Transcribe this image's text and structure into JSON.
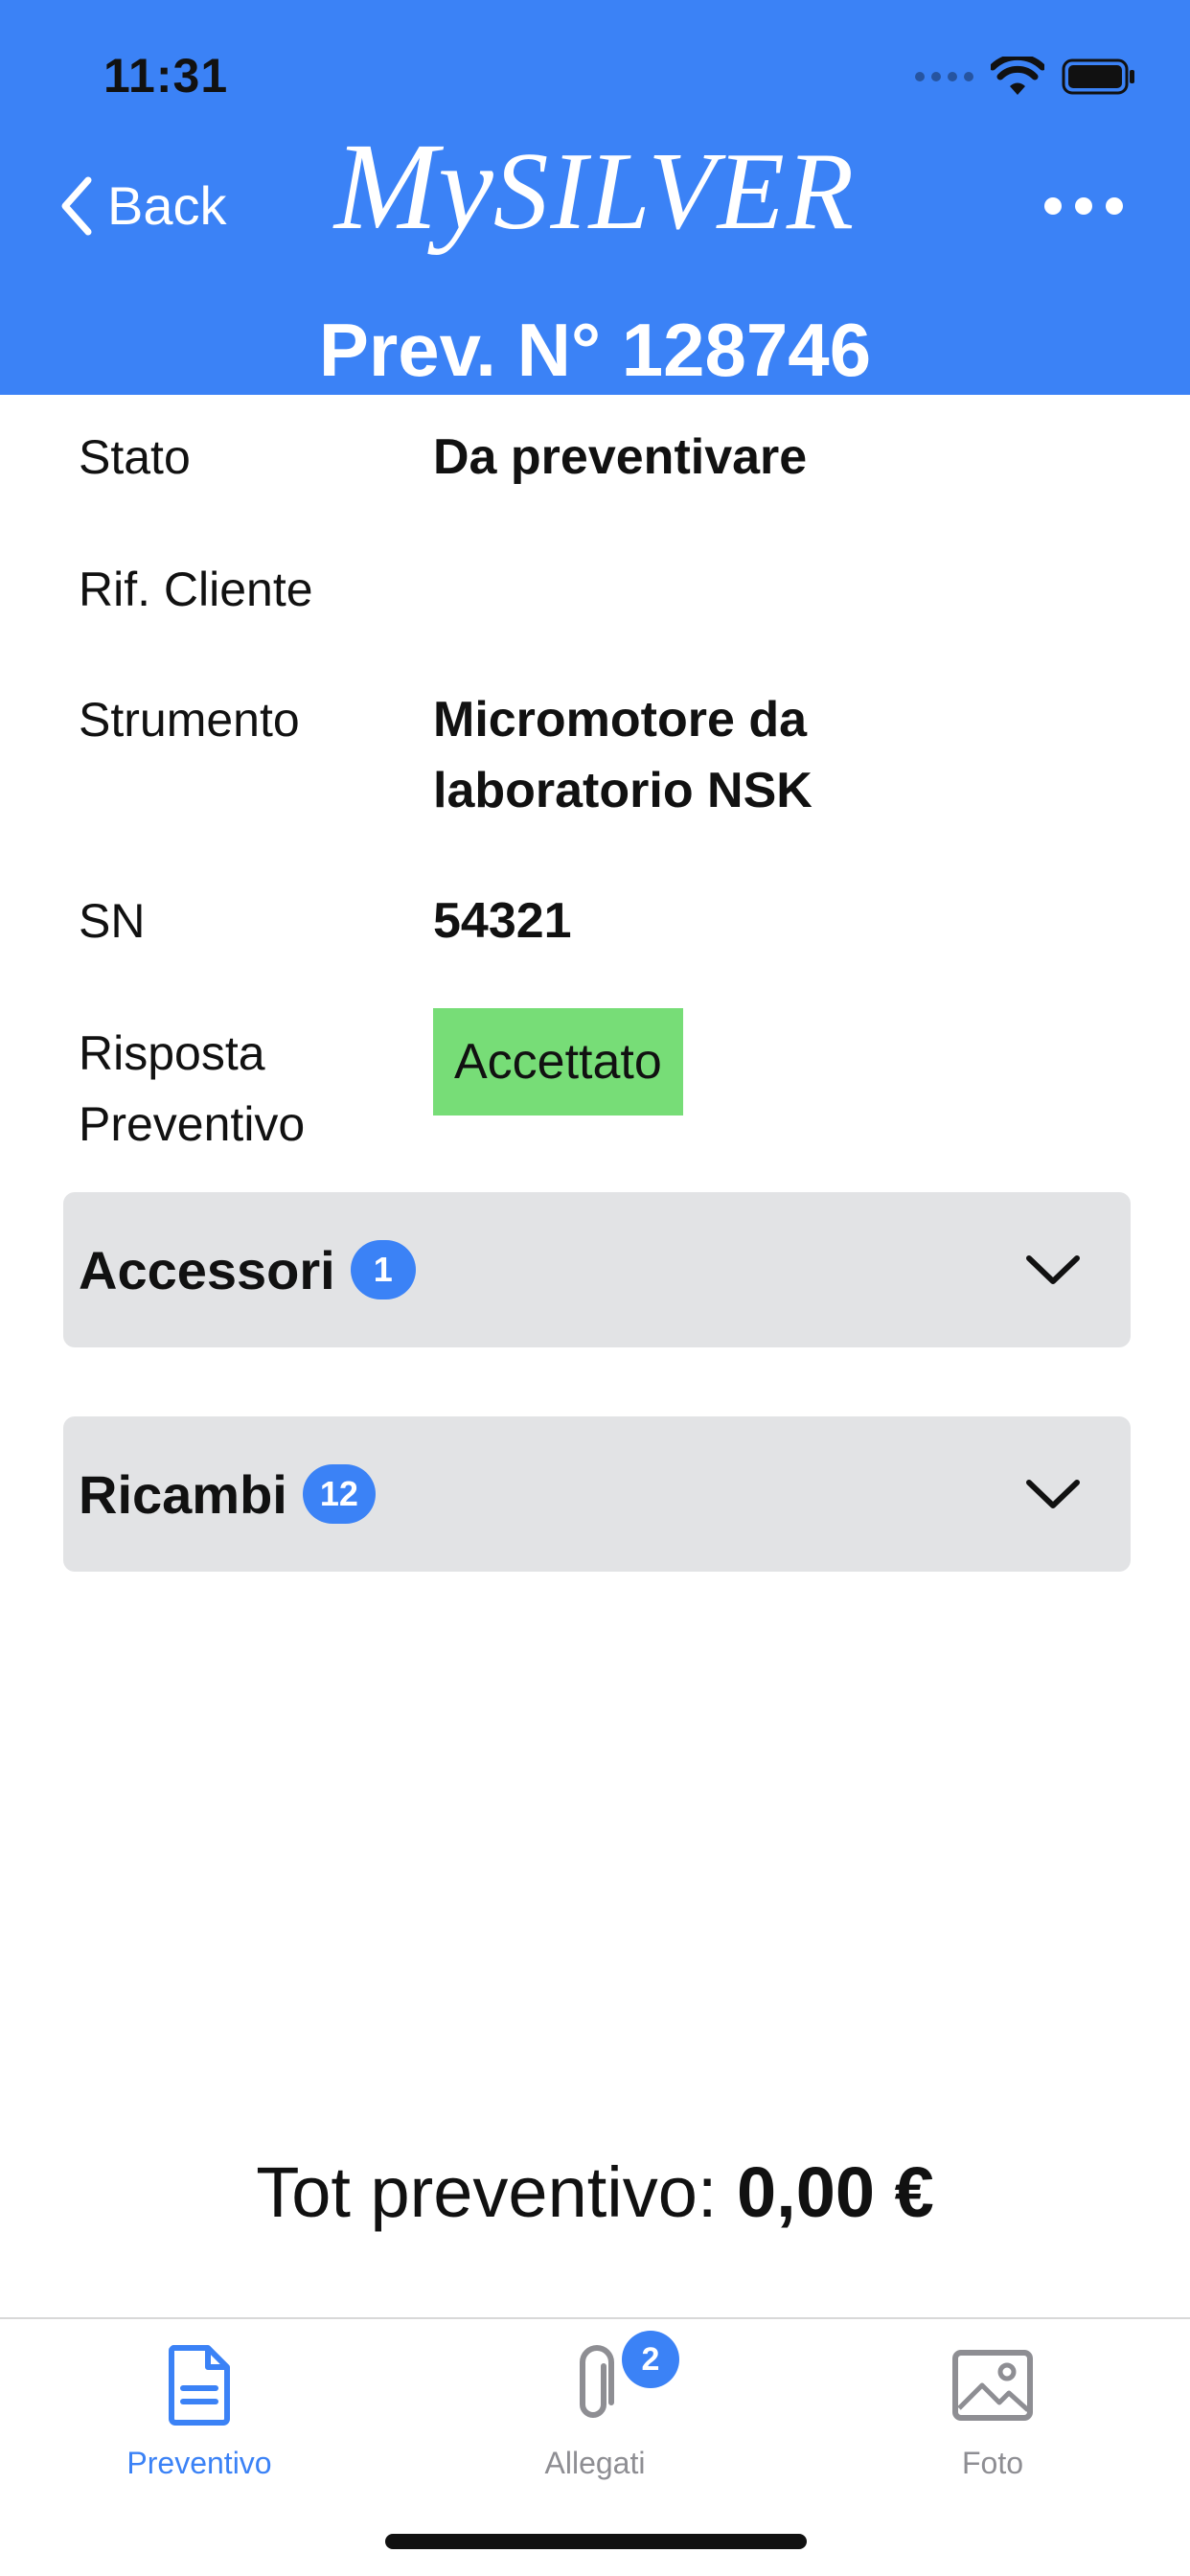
{
  "status_bar": {
    "time": "11:31"
  },
  "nav": {
    "back_label": "Back",
    "brand_my": "My",
    "brand_silver": "SILVER",
    "doc_title": "Prev. N° 128746"
  },
  "details": {
    "stato_label": "Stato",
    "stato_value": "Da preventivare",
    "rif_cliente_label": "Rif. Cliente",
    "rif_cliente_value": "",
    "strumento_label": "Strumento",
    "strumento_value_line1": "Micromotore da",
    "strumento_value_line2": "laboratorio NSK",
    "sn_label": "SN",
    "sn_value": "54321",
    "risposta_label_line1": "Risposta",
    "risposta_label_line2": "Preventivo",
    "risposta_value": "Accettato"
  },
  "sections": [
    {
      "title": "Accessori",
      "count": "1"
    },
    {
      "title": "Ricambi",
      "count": "12"
    }
  ],
  "total": {
    "label": "Tot preventivo:",
    "value": "0,00 €"
  },
  "tabs": [
    {
      "label": "Preventivo",
      "icon": "document-icon",
      "active": true
    },
    {
      "label": "Allegati",
      "icon": "paperclip-icon",
      "badge": "2",
      "active": false
    },
    {
      "label": "Foto",
      "icon": "photo-icon",
      "active": false
    }
  ],
  "colors": {
    "header_bg": "#3b82f6",
    "accent": "#3b82f6",
    "accepted_chip": "#77dd77",
    "accordion_bg": "#e2e3e5"
  }
}
